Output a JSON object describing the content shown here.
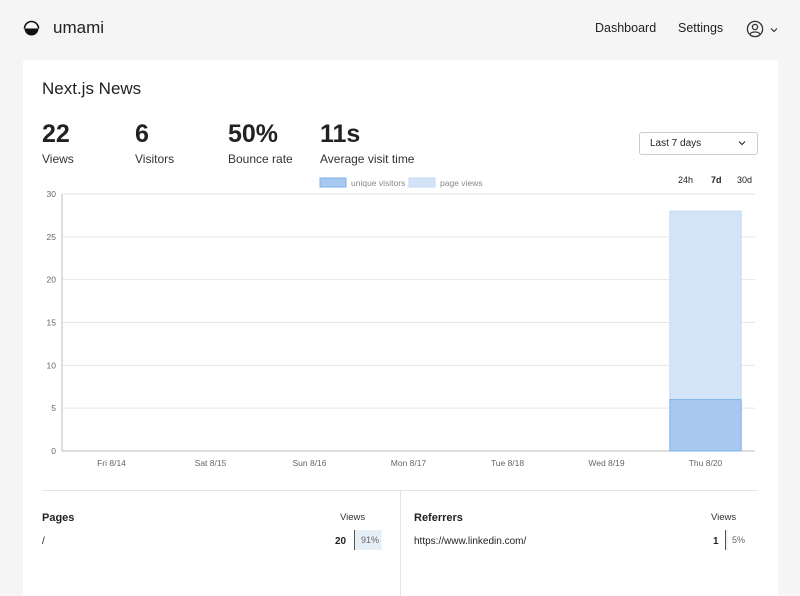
{
  "app": {
    "name": "umami"
  },
  "nav": {
    "dashboard": "Dashboard",
    "settings": "Settings"
  },
  "site": {
    "title": "Next.js News"
  },
  "metrics": [
    {
      "value": "22",
      "label": "Views"
    },
    {
      "value": "6",
      "label": "Visitors"
    },
    {
      "value": "50%",
      "label": "Bounce rate"
    },
    {
      "value": "11s",
      "label": "Average visit time"
    }
  ],
  "date_range": {
    "selected": "Last 7 days",
    "buttons": [
      "24h",
      "7d",
      "30d"
    ],
    "active": "7d"
  },
  "colors": {
    "unique_visitors": "#a8c8f0",
    "page_views": "#d4e4f8",
    "accent": "#2680eb"
  },
  "chart_data": {
    "type": "bar",
    "categories": [
      "Fri 8/14",
      "Sat 8/15",
      "Sun 8/16",
      "Mon 8/17",
      "Tue 8/18",
      "Wed 8/19",
      "Thu 8/20"
    ],
    "series": [
      {
        "name": "unique visitors",
        "values": [
          0,
          0,
          0,
          0,
          0,
          0,
          6
        ]
      },
      {
        "name": "page views",
        "values": [
          0,
          0,
          0,
          0,
          0,
          0,
          28
        ]
      }
    ],
    "y_ticks": [
      "0",
      "5",
      "10",
      "15",
      "20",
      "25",
      "30"
    ],
    "ylim": [
      0,
      30
    ],
    "legend_position": "top-center",
    "grid": true
  },
  "pages": {
    "title": "Pages",
    "column": "Views",
    "rows": [
      {
        "label": "/",
        "value": "20",
        "percent": "91%",
        "fill": 0.91
      }
    ]
  },
  "referrers": {
    "title": "Referrers",
    "column": "Views",
    "rows": [
      {
        "label": "https://www.linkedin.com/",
        "value": "1",
        "percent": "5%",
        "fill": 0.05
      }
    ]
  }
}
